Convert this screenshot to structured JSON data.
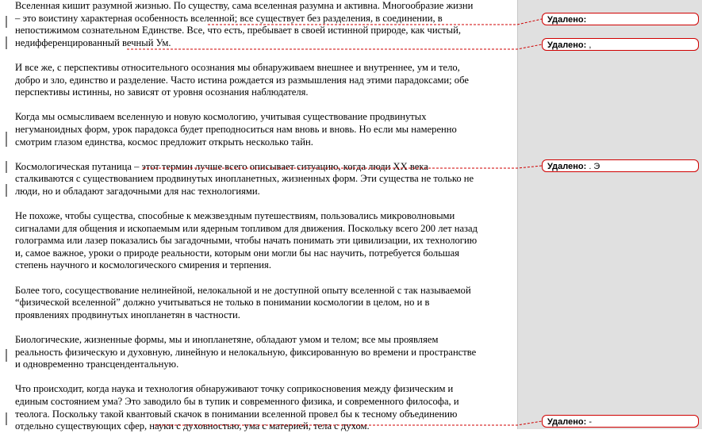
{
  "document": {
    "paragraphs": [
      [
        "Вселенная кишит разумной жизнью.  По существу, сама вселенная разумна и активна. Многообразие жизни",
        "– это воистину характерная особенность вселенной; все существует без разделения, в соединении, в",
        "непостижимом сознательном Единстве.  Все, что есть, пребывает в своей истинной природе, как чистый,",
        "недифференцированный вечный Ум."
      ],
      [
        "И все же, с перспективы относительного осознания мы обнаруживаем внешнее и внутреннее, ум и тело,",
        "добро и зло, единство и разделение. Часто истина рождается из размышления над этими парадоксами; обе",
        "перспективы истинны, но зависят от уровня осознания наблюдателя."
      ],
      [
        "Когда мы осмысливаем вселенную и новую космологию, учитывая существование продвинутых",
        "негуманоидных форм, урок парадокса будет преподноситься нам вновь и вновь.  Но если мы намеренно",
        "смотрим глазом единства, космос предложит открыть несколько тайн."
      ],
      [
        "Космологическая путаница – этот термин лучше всего описывает ситуацию, когда люди XX века",
        "сталкиваются с существованием продвинутых инопланетных, жизненных форм. Эти существа не только не",
        "люди, но и обладают загадочными для нас технологиями."
      ],
      [
        "Не похоже, чтобы существа, способные к межзвездным  путешествиям, пользовались микроволновыми",
        "сигналами для общения и ископаемым или ядерным топливом для движения. Поскольку всего 200 лет назад",
        "голограмма или лазер показались бы загадочными, чтобы начать понимать эти цивилизации, их технологию",
        "и, самое важное, уроки о природе реальности, которым они могли бы нас научить, потребуется большая",
        "степень научного и космологического  смирения и терпения."
      ],
      [
        "Более того, сосуществование нелинейной, нелокальной и не доступной опыту вселенной с так называемой",
        "“физической вселенной” должно учитываться не только в понимании космологии в целом, но и в",
        "проявлениях продвинутых инопланетян в частности."
      ],
      [
        "Биологические, жизненные формы, мы и инопланетяне, обладают умом и телом; все мы проявляем",
        "реальность физическую и духовную, линейную и нелокальную, фиксированную во времени и пространстве",
        "и одновременно трансцендентальную."
      ],
      [
        "Что происходит, когда наука и технология обнаруживают точку соприкосновения между физическим  и",
        "единым состоянием ума? Это заводило бы в тупик и современного физика, и современного философа, и",
        "теолога. Поскольку такой квантовый скачок в понимании вселенной провел бы к тесному объединению",
        "отдельно существующих сфер, науки с духовностью, ума с материей, тела с духом."
      ]
    ]
  },
  "comments": [
    {
      "label": "Удалено:",
      "value": ""
    },
    {
      "label": "Удалено:",
      "value": ","
    },
    {
      "label": "Удалено:",
      "value": ". Э"
    },
    {
      "label": "Удалено:",
      "value": "-"
    }
  ],
  "colors": {
    "revision": "#d00000",
    "margin_bg": "#e0e0e0"
  }
}
